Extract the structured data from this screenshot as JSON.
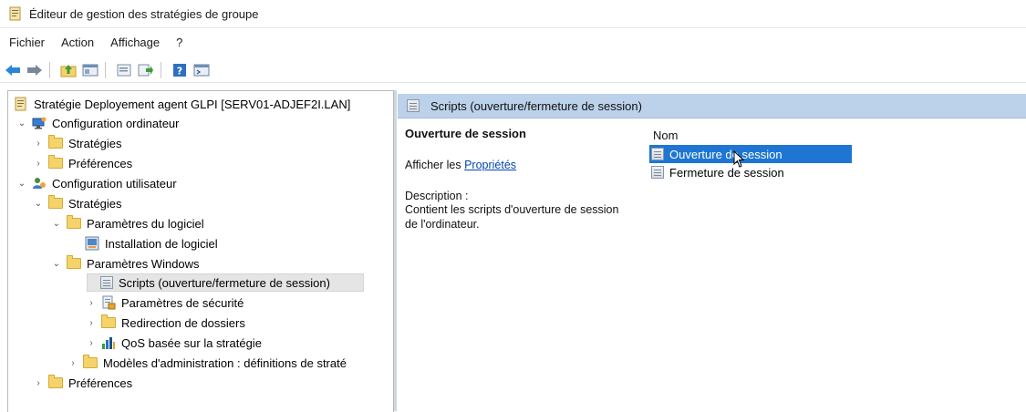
{
  "window": {
    "title": "Éditeur de gestion des stratégies de groupe"
  },
  "menu": [
    "Fichier",
    "Action",
    "Affichage",
    "?"
  ],
  "toolbar": {
    "icons": [
      "back-arrow-icon",
      "forward-arrow-icon",
      "up-folder-icon",
      "show-hide-tree-icon",
      "properties-icon",
      "export-list-icon",
      "help-icon",
      "console-icon"
    ]
  },
  "tree": {
    "root": "Stratégie Deployement agent GLPI [SERV01-ADJEF2I.LAN]",
    "items": [
      {
        "label": "Configuration ordinateur"
      },
      {
        "label": "Stratégies"
      },
      {
        "label": "Préférences"
      },
      {
        "label": "Configuration utilisateur"
      },
      {
        "label": "Stratégies"
      },
      {
        "label": "Paramètres du logiciel"
      },
      {
        "label": "Installation de logiciel"
      },
      {
        "label": "Paramètres Windows"
      },
      {
        "label": "Scripts (ouverture/fermeture de session)"
      },
      {
        "label": "Paramètres de sécurité"
      },
      {
        "label": "Redirection de dossiers"
      },
      {
        "label": "QoS basée sur la stratégie"
      },
      {
        "label": "Modèles d'administration : définitions de straté"
      },
      {
        "label": "Préférences"
      }
    ]
  },
  "right": {
    "header": "Scripts (ouverture/fermeture de session)",
    "selected_title": "Ouverture de session",
    "show_prefix": "Afficher les ",
    "properties_link": "Propriétés",
    "description_label": "Description :",
    "description_text": "Contient les scripts d'ouverture de session de l'ordinateur.",
    "column_name": "Nom",
    "list": [
      {
        "label": "Ouverture de session",
        "selected": true
      },
      {
        "label": "Fermeture de session",
        "selected": false
      }
    ]
  },
  "colors": {
    "selection": "#1e76d2",
    "header": "#bcd1ea",
    "link": "#0645ad"
  }
}
